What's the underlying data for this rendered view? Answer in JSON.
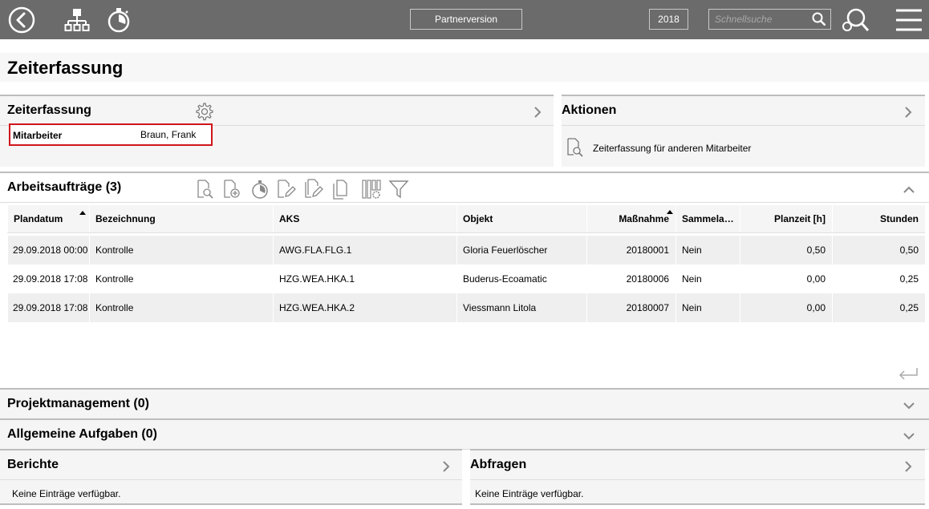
{
  "topbar": {
    "partner_version": "Partnerversion",
    "year": "2018",
    "search_placeholder": "Schnellsuche"
  },
  "page": {
    "title": "Zeiterfassung"
  },
  "zeiterfassung_panel": {
    "title": "Zeiterfassung",
    "employee_label": "Mitarbeiter",
    "employee_value": "Braun, Frank"
  },
  "actions_panel": {
    "title": "Aktionen",
    "items": [
      {
        "label": "Zeiterfassung für anderen Mitarbeiter",
        "icon": "document-search-icon"
      }
    ]
  },
  "work_orders": {
    "title": "Arbeitsaufträge (3)",
    "columns": [
      "Plandatum",
      "Bezeichnung",
      "AKS",
      "Objekt",
      "Maßnahme",
      "Sammelau…",
      "Planzeit [h]",
      "Stunden"
    ],
    "rows": [
      {
        "plandatum": "29.09.2018 00:00",
        "bezeichnung": "Kontrolle",
        "aks": "AWG.FLA.FLG.1",
        "objekt": "Gloria Feuerlöscher",
        "massnahme": "20180001",
        "sammel": "Nein",
        "planzeit": "0,50",
        "stunden": "0,50"
      },
      {
        "plandatum": "29.09.2018 17:08",
        "bezeichnung": "Kontrolle",
        "aks": "HZG.WEA.HKA.1",
        "objekt": "Buderus-Ecoamatic",
        "massnahme": "20180006",
        "sammel": "Nein",
        "planzeit": "0,00",
        "stunden": "0,25"
      },
      {
        "plandatum": "29.09.2018 17:08",
        "bezeichnung": "Kontrolle",
        "aks": "HZG.WEA.HKA.2",
        "objekt": "Viessmann Litola",
        "massnahme": "20180007",
        "sammel": "Nein",
        "planzeit": "0,00",
        "stunden": "0,25"
      }
    ]
  },
  "project_management": {
    "title": "Projektmanagement (0)"
  },
  "general_tasks": {
    "title": "Allgemeine Aufgaben (0)"
  },
  "reports": {
    "title": "Berichte",
    "empty": "Keine Einträge verfügbar."
  },
  "queries": {
    "title": "Abfragen",
    "empty": "Keine Einträge verfügbar."
  },
  "colors": {
    "topbar": "#6b6b6b",
    "highlight_border": "#d0141c",
    "panel_bg": "#f5f5f5",
    "row_alt": "#efefef"
  }
}
